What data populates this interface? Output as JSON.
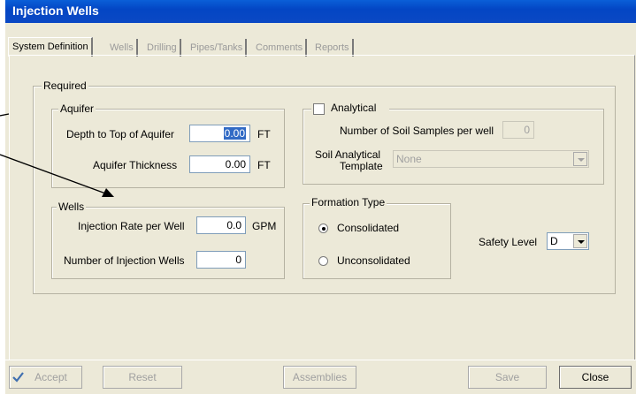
{
  "window": {
    "title": "Injection Wells"
  },
  "tabs": [
    {
      "label": "System Definition",
      "active": true
    },
    {
      "label": "Wells",
      "active": false
    },
    {
      "label": "Drilling",
      "active": false
    },
    {
      "label": "Pipes/Tanks",
      "active": false
    },
    {
      "label": "Comments",
      "active": false
    },
    {
      "label": "Reports",
      "active": false
    }
  ],
  "required": {
    "legend": "Required"
  },
  "aquifer": {
    "legend": "Aquifer",
    "depth_label": "Depth to Top of Aquifer",
    "depth_value": "0.00",
    "depth_unit": "FT",
    "thickness_label": "Aquifer Thickness",
    "thickness_value": "0.00",
    "thickness_unit": "FT"
  },
  "analytical": {
    "label": "Analytical",
    "checked": false,
    "samples_label": "Number of Soil Samples per well",
    "samples_value": "0",
    "template_label_line1": "Soil Analytical",
    "template_label_line2": "Template",
    "template_value": "None"
  },
  "wells": {
    "legend": "Wells",
    "rate_label": "Injection Rate per Well",
    "rate_value": "0.0",
    "rate_unit": "GPM",
    "count_label": "Number of Injection Wells",
    "count_value": "0"
  },
  "formation": {
    "legend": "Formation Type",
    "options": [
      {
        "label": "Consolidated",
        "selected": true
      },
      {
        "label": "Unconsolidated",
        "selected": false
      }
    ]
  },
  "safety": {
    "label": "Safety Level",
    "value": "D"
  },
  "buttons": {
    "accept": "Accept",
    "reset": "Reset",
    "assemblies": "Assemblies",
    "save": "Save",
    "close": "Close"
  },
  "icons": {
    "accept": "check-icon",
    "dropdown": "chevron-down-icon"
  }
}
